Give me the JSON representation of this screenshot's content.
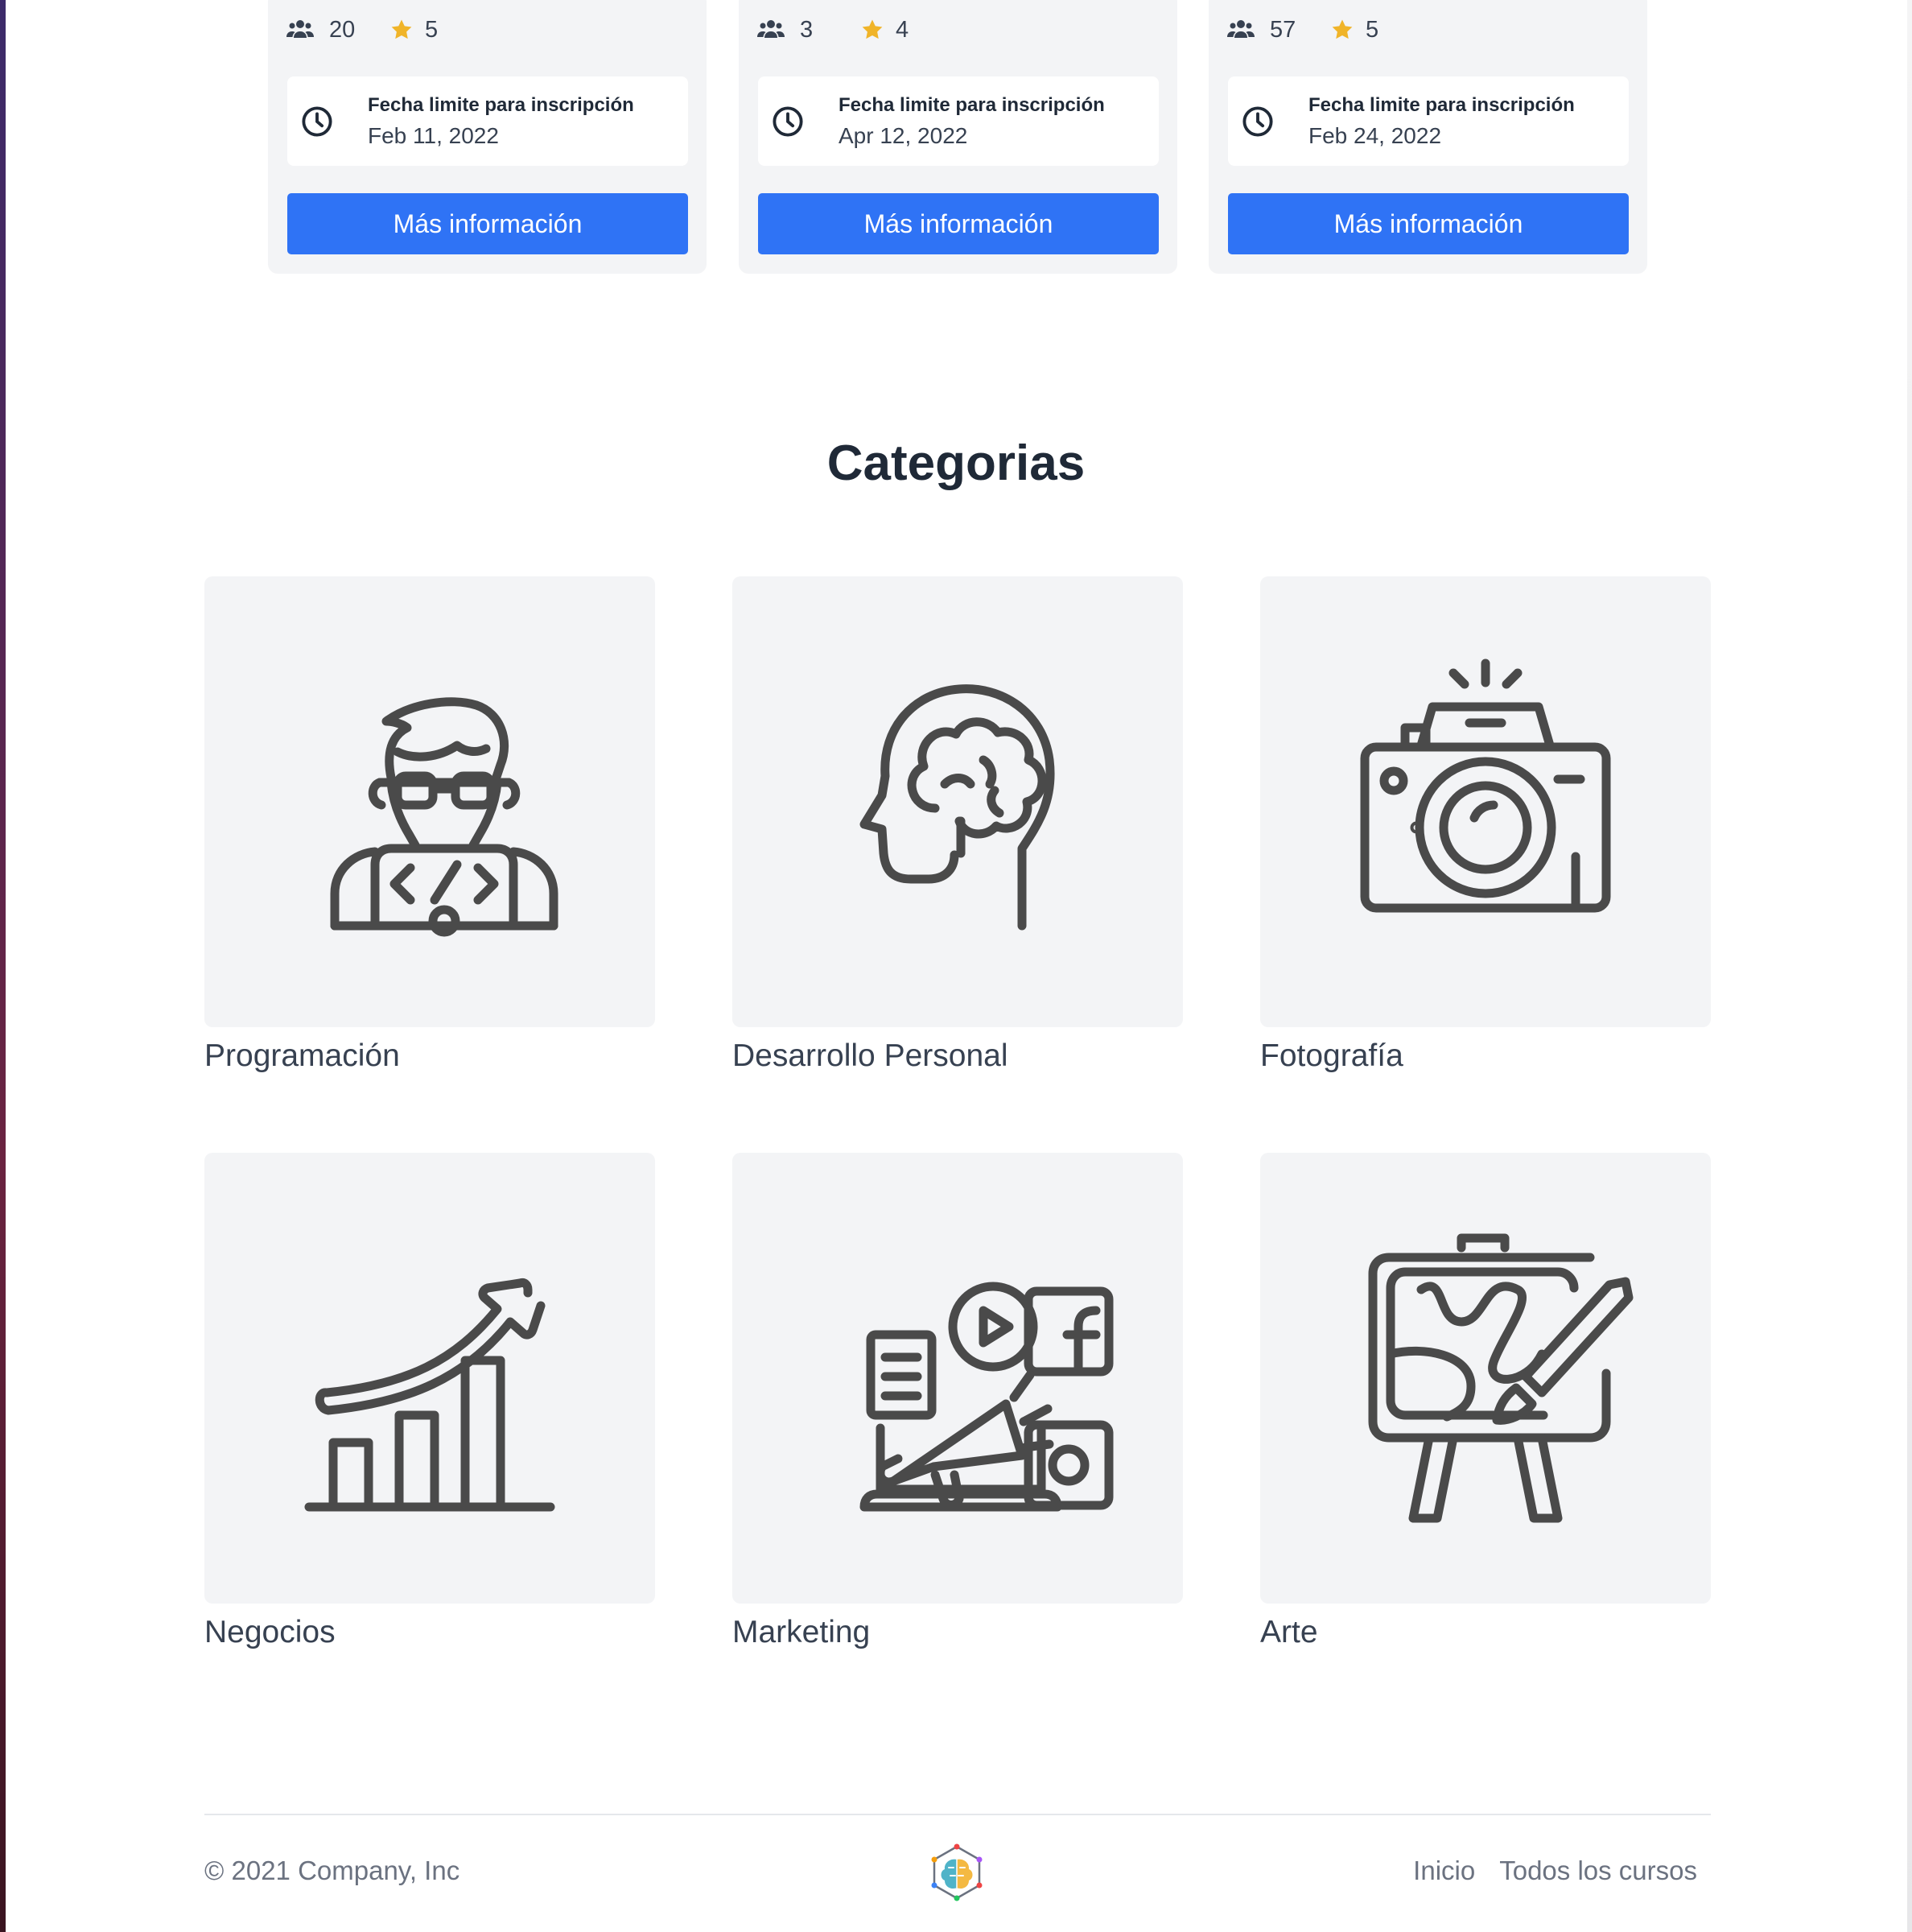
{
  "courses": [
    {
      "students": "20",
      "rating": "5",
      "deadline_label": "Fecha limite para inscripción",
      "deadline_date": "Feb 11, 2022",
      "button_label": "Más información"
    },
    {
      "students": "3",
      "rating": "4",
      "deadline_label": "Fecha limite para inscripción",
      "deadline_date": "Apr 12, 2022",
      "button_label": "Más información"
    },
    {
      "students": "57",
      "rating": "5",
      "deadline_label": "Fecha limite para inscripción",
      "deadline_date": "Feb 24, 2022",
      "button_label": "Más información"
    }
  ],
  "categories_section": {
    "title": "Categorias",
    "items": [
      {
        "name": "Programación",
        "icon": "programmer-icon"
      },
      {
        "name": "Desarrollo Personal",
        "icon": "head-brain-icon"
      },
      {
        "name": "Fotografía",
        "icon": "camera-icon"
      },
      {
        "name": "Negocios",
        "icon": "growth-chart-icon"
      },
      {
        "name": "Marketing",
        "icon": "megaphone-social-icon"
      },
      {
        "name": "Arte",
        "icon": "easel-icon"
      }
    ]
  },
  "footer": {
    "copyright": "© 2021 Company, Inc",
    "nav": [
      "Inicio",
      "Todos los cursos"
    ]
  },
  "colors": {
    "primary_button": "#2f73f5",
    "card_bg": "#f3f4f6",
    "star": "#f0b429",
    "icon_stroke": "#4a4a4a"
  }
}
